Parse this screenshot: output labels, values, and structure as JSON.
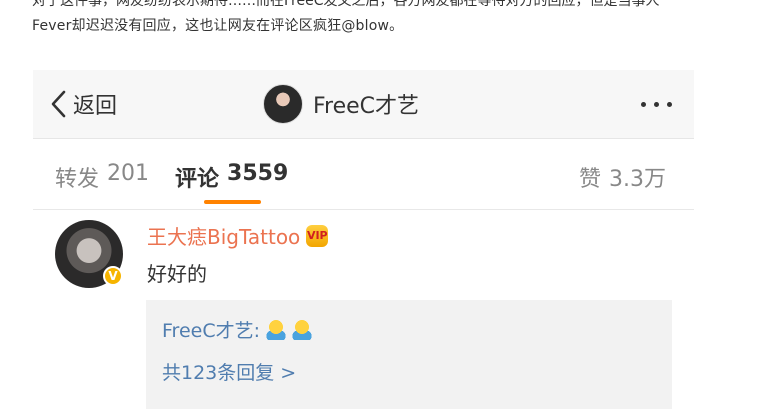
{
  "article": {
    "top_text": "对于这件事，网友纷纷表示期待……而在FreeC发文之后，各方网友都在等待对方的回应，但是当事人",
    "caption": "Fever却迟迟没有回应，这也让网友在评论区疯狂@blow。"
  },
  "navbar": {
    "back_label": "返回",
    "title": "FreeC才艺"
  },
  "tabs": [
    {
      "label": "转发",
      "count": "201"
    },
    {
      "label": "评论",
      "count": "3559"
    },
    {
      "label": "赞",
      "count": "3.3万"
    }
  ],
  "comment": {
    "username": "王大痣BigTattoo",
    "verified_badge": "V",
    "vip_badge": "VIP",
    "text": "好好的",
    "reply": {
      "author": "FreeC才艺:",
      "more_link": "共123条回复 >"
    }
  },
  "colors": {
    "accent": "#ff8200",
    "username": "#eb7350",
    "link": "#507daf"
  }
}
